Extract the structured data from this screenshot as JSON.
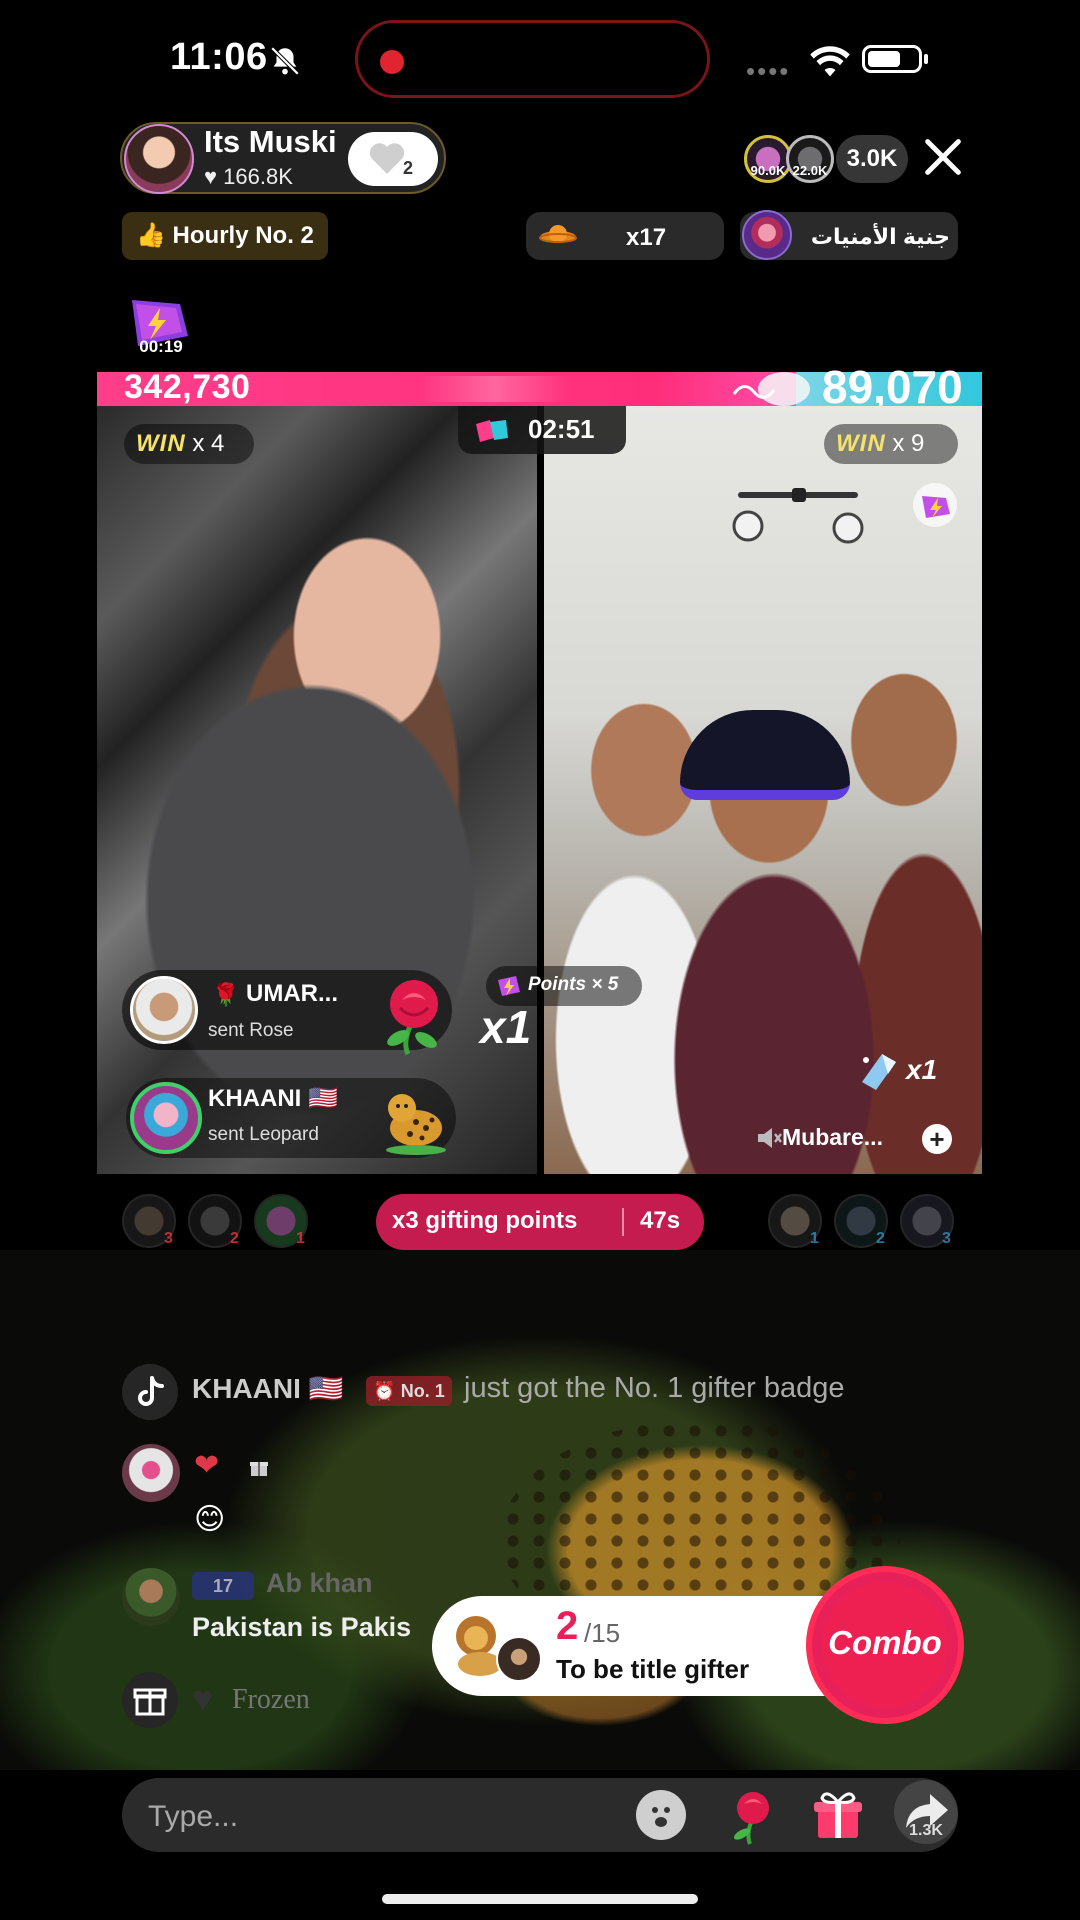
{
  "status_bar": {
    "time": "11:06"
  },
  "host": {
    "name": "Its Muski",
    "likes": "♥ 166.8K",
    "follow_count": "2"
  },
  "viewers": {
    "avatar1_badge": "90.0K",
    "avatar2_badge": "22.0K",
    "count": "3.0K"
  },
  "hourly_rank": "👍 Hourly No. 2",
  "planet_gift": {
    "count": "x17"
  },
  "wish_fairy": {
    "label": "جنية الأمنيات"
  },
  "boost": {
    "timer": "00:19"
  },
  "battle": {
    "left_score": "342,730",
    "right_score": "89,070",
    "timer": "02:51",
    "left_wins": {
      "word": "WIN",
      "count": "x 4"
    },
    "right_wins": {
      "word": "WIN",
      "count": "x 9"
    },
    "left_share": 0.79
  },
  "gift_notifications": [
    {
      "name": "UMAR...",
      "action": "sent Rose",
      "combo": "x1"
    },
    {
      "name": "KHAANI 🇺🇸",
      "action": "sent Leopard"
    }
  ],
  "points_pill": "Points × 5",
  "right_guest": {
    "gift_count": "x1",
    "name": "Mubare...",
    "plus": "+"
  },
  "ranks": {
    "left": [
      "3",
      "2",
      "1"
    ],
    "right": [
      "1",
      "2",
      "3"
    ]
  },
  "gifting_points": {
    "label": "x3 gifting points",
    "time": "47s"
  },
  "chat": {
    "row1": {
      "name": "KHAANI 🇺🇸",
      "badge": "⏰ No. 1",
      "text": "just got the No. 1 gifter badge"
    },
    "row2": {
      "emoji": "😊"
    },
    "row3": {
      "level": "17",
      "name": "Ab khan",
      "text": "Pakistan is Pakis"
    },
    "row4": {
      "text": "Frozen"
    }
  },
  "combo_card": {
    "current": "2",
    "total": "/15",
    "subtitle": "To be title gifter",
    "button": "Combo"
  },
  "bottom_bar": {
    "placeholder": "Type...",
    "share_count": "1.3K"
  },
  "colors": {
    "accent": "#ee2052",
    "left_team": "#ff2e7a",
    "right_team": "#31c7dd",
    "win_text": "#f4e26c"
  }
}
